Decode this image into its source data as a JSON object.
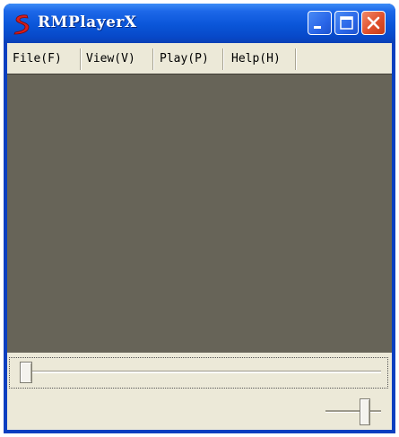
{
  "window": {
    "title": "RMPlayerX",
    "buttons": {
      "minimize_icon": "minimize-icon",
      "maximize_icon": "maximize-icon",
      "close_icon": "close-icon"
    }
  },
  "menu": {
    "items": [
      {
        "label": "File(F)"
      },
      {
        "label": "View(V)"
      },
      {
        "label": "Play(P)"
      },
      {
        "label": "Help(H)"
      }
    ]
  },
  "playback": {
    "seek_position": 0.0,
    "volume_level": 0.75
  },
  "colors": {
    "titlebar_blue": "#0a55d8",
    "close_red": "#e0502c",
    "video_background": "#676458",
    "window_face": "#ece9d8",
    "app_icon_red": "#d81e1e"
  }
}
